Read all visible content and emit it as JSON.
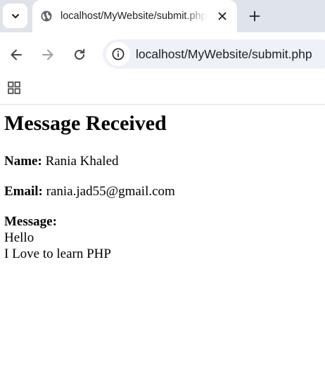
{
  "browser": {
    "tab": {
      "title": "localhost/MyWebsite/submit.php",
      "favicon": "globe-icon"
    },
    "address_bar": {
      "url": "localhost/MyWebsite/submit.php",
      "site_info_icon": "info-icon"
    },
    "icons": {
      "tab_search": "chevron-down-icon",
      "close": "close-icon",
      "new_tab": "plus-icon",
      "back": "arrow-left-icon",
      "forward": "arrow-right-icon",
      "reload": "reload-icon",
      "apps": "apps-grid-icon"
    }
  },
  "page": {
    "heading": "Message Received",
    "name_label": "Name:",
    "name_value": "Rania Khaled",
    "email_label": "Email:",
    "email_value": "rania.jad55@gmail.com",
    "message_label": "Message:",
    "message_lines": [
      "Hello",
      "I Love to learn PHP"
    ]
  },
  "colors": {
    "tabstrip_bg": "#dfe3eb",
    "omnibox_bg": "#eef1f7",
    "icon": "#474747",
    "icon_disabled": "#a0a0a0",
    "text": "#000000"
  }
}
